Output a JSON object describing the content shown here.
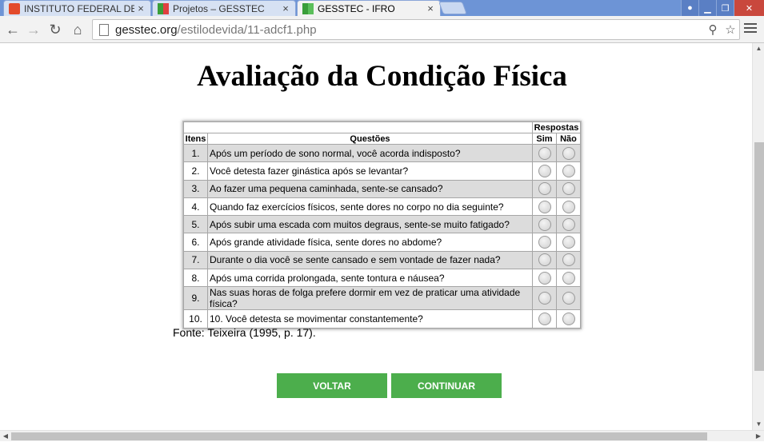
{
  "tabs": [
    {
      "label": "INSTITUTO FEDERAL DE E",
      "favicon": "if-logo-icon",
      "close": "×"
    },
    {
      "label": "Projetos – GESSTEC",
      "favicon": "grid-favicon-icon",
      "close": "×"
    },
    {
      "label": "GESSTEC - IFRO",
      "favicon": "grid-favicon-icon",
      "close": "×"
    }
  ],
  "address_bar": {
    "domain": "gesstec.org",
    "path": "/estilodevida/11-adcf1.php"
  },
  "page": {
    "title": "Avaliação da Condição Física",
    "table": {
      "header_group": "Respostas",
      "col_items": "Itens",
      "col_questions": "Questões",
      "col_yes": "Sim",
      "col_no": "Não",
      "rows": [
        {
          "num": "1.",
          "q": "Após um período de sono normal, você acorda indisposto?"
        },
        {
          "num": "2.",
          "q": "Você detesta fazer ginástica após se levantar?"
        },
        {
          "num": "3.",
          "q": "Ao fazer uma pequena caminhada, sente-se cansado?"
        },
        {
          "num": "4.",
          "q": "Quando faz exercícios físicos, sente dores no corpo no dia seguinte?"
        },
        {
          "num": "5.",
          "q": "Após subir uma escada com muitos degraus, sente-se muito fatigado?"
        },
        {
          "num": "6.",
          "q": "Após grande atividade física, sente dores no abdome?"
        },
        {
          "num": "7.",
          "q": "Durante o dia você se sente cansado e sem vontade de fazer nada?"
        },
        {
          "num": "8.",
          "q": "Após uma corrida prolongada, sente tontura e náusea?"
        },
        {
          "num": "9.",
          "q": "Nas suas horas de folga prefere dormir em vez de praticar uma atividade física?"
        },
        {
          "num": "10.",
          "q": "10. Você detesta se movimentar constantemente?"
        }
      ]
    },
    "source": "Fonte: Teixeira (1995, p. 17).",
    "back_button": "VOLTAR",
    "continue_button": "CONTINUAR"
  },
  "colors": {
    "button_green": "#4cae4c",
    "row_shade": "#dcdcdc",
    "tabstrip": "#6d94d6"
  }
}
